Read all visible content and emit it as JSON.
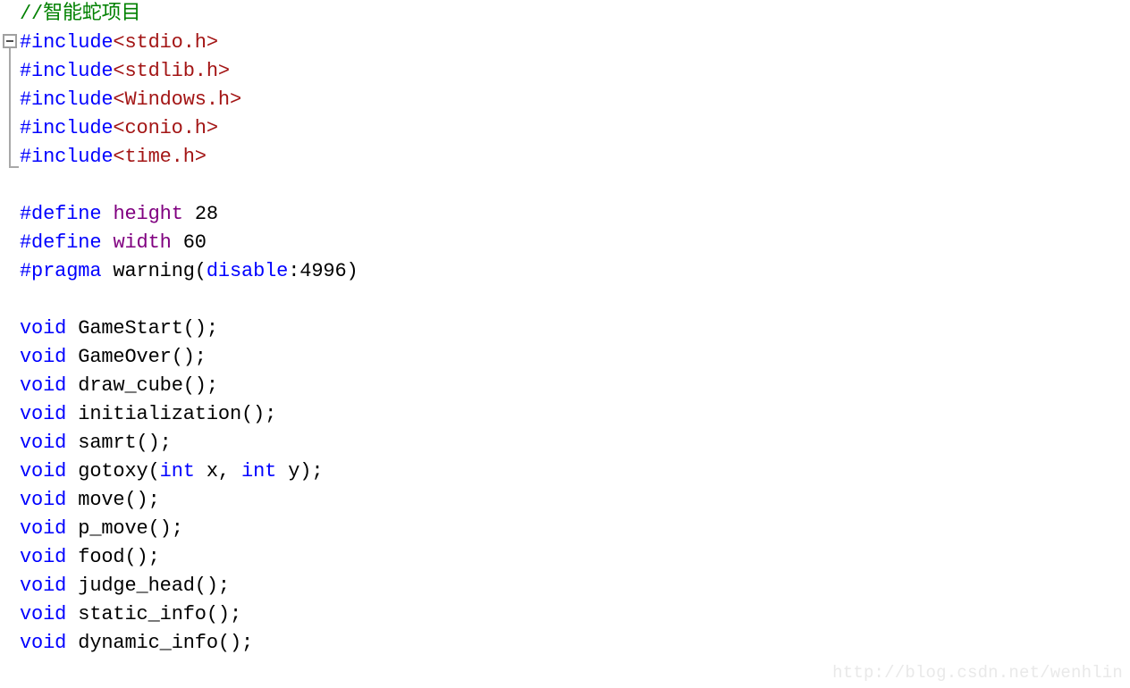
{
  "editor": {
    "background_color": "#ffffff",
    "font_size_px": 22,
    "line_height_px": 32,
    "colors": {
      "comment": "#008000",
      "preprocessor": "#0000ff",
      "header_name": "#a31515",
      "macro_name": "#800080",
      "keyword": "#0000ff",
      "plain_text": "#000000",
      "fold_margin": "#a8a8a8",
      "watermark": "#e9e9e9"
    },
    "fold_region": {
      "glyph": "minus-box",
      "collapsed": false,
      "covers_lines": "2-6"
    },
    "lines": [
      {
        "n": 1,
        "tokens": [
          {
            "t": "//智能蛇项目",
            "c": "comment"
          }
        ]
      },
      {
        "n": 2,
        "tokens": [
          {
            "t": "#include",
            "c": "pre"
          },
          {
            "t": "<stdio.h>",
            "c": "header"
          }
        ]
      },
      {
        "n": 3,
        "tokens": [
          {
            "t": "#include",
            "c": "pre"
          },
          {
            "t": "<stdlib.h>",
            "c": "header"
          }
        ]
      },
      {
        "n": 4,
        "tokens": [
          {
            "t": "#include",
            "c": "pre"
          },
          {
            "t": "<Windows.h>",
            "c": "header"
          }
        ]
      },
      {
        "n": 5,
        "tokens": [
          {
            "t": "#include",
            "c": "pre"
          },
          {
            "t": "<conio.h>",
            "c": "header"
          }
        ]
      },
      {
        "n": 6,
        "tokens": [
          {
            "t": "#include",
            "c": "pre"
          },
          {
            "t": "<time.h>",
            "c": "header"
          }
        ]
      },
      {
        "n": 7,
        "tokens": []
      },
      {
        "n": 8,
        "tokens": [
          {
            "t": "#define",
            "c": "pre"
          },
          {
            "t": " ",
            "c": "plain"
          },
          {
            "t": "height",
            "c": "macro"
          },
          {
            "t": " 28",
            "c": "plain"
          }
        ]
      },
      {
        "n": 9,
        "tokens": [
          {
            "t": "#define",
            "c": "pre"
          },
          {
            "t": " ",
            "c": "plain"
          },
          {
            "t": "width",
            "c": "macro"
          },
          {
            "t": " 60",
            "c": "plain"
          }
        ]
      },
      {
        "n": 10,
        "tokens": [
          {
            "t": "#pragma",
            "c": "pre"
          },
          {
            "t": " warning(",
            "c": "plain"
          },
          {
            "t": "disable",
            "c": "keyword"
          },
          {
            "t": ":4996)",
            "c": "plain"
          }
        ]
      },
      {
        "n": 11,
        "tokens": []
      },
      {
        "n": 12,
        "tokens": [
          {
            "t": "void",
            "c": "keyword"
          },
          {
            "t": " GameStart();",
            "c": "plain"
          }
        ]
      },
      {
        "n": 13,
        "tokens": [
          {
            "t": "void",
            "c": "keyword"
          },
          {
            "t": " GameOver();",
            "c": "plain"
          }
        ]
      },
      {
        "n": 14,
        "tokens": [
          {
            "t": "void",
            "c": "keyword"
          },
          {
            "t": " draw_cube();",
            "c": "plain"
          }
        ]
      },
      {
        "n": 15,
        "tokens": [
          {
            "t": "void",
            "c": "keyword"
          },
          {
            "t": " initialization();",
            "c": "plain"
          }
        ]
      },
      {
        "n": 16,
        "tokens": [
          {
            "t": "void",
            "c": "keyword"
          },
          {
            "t": " samrt();",
            "c": "plain"
          }
        ]
      },
      {
        "n": 17,
        "tokens": [
          {
            "t": "void",
            "c": "keyword"
          },
          {
            "t": " gotoxy(",
            "c": "plain"
          },
          {
            "t": "int",
            "c": "keyword"
          },
          {
            "t": " x, ",
            "c": "plain"
          },
          {
            "t": "int",
            "c": "keyword"
          },
          {
            "t": " y);",
            "c": "plain"
          }
        ]
      },
      {
        "n": 18,
        "tokens": [
          {
            "t": "void",
            "c": "keyword"
          },
          {
            "t": " move();",
            "c": "plain"
          }
        ]
      },
      {
        "n": 19,
        "tokens": [
          {
            "t": "void",
            "c": "keyword"
          },
          {
            "t": " p_move();",
            "c": "plain"
          }
        ]
      },
      {
        "n": 20,
        "tokens": [
          {
            "t": "void",
            "c": "keyword"
          },
          {
            "t": " food();",
            "c": "plain"
          }
        ]
      },
      {
        "n": 21,
        "tokens": [
          {
            "t": "void",
            "c": "keyword"
          },
          {
            "t": " judge_head();",
            "c": "plain"
          }
        ]
      },
      {
        "n": 22,
        "tokens": [
          {
            "t": "void",
            "c": "keyword"
          },
          {
            "t": " static_info();",
            "c": "plain"
          }
        ]
      },
      {
        "n": 23,
        "tokens": [
          {
            "t": "void",
            "c": "keyword"
          },
          {
            "t": " dynamic_info();",
            "c": "plain"
          }
        ]
      }
    ]
  },
  "watermark": {
    "text": "http://blog.csdn.net/wenhlin"
  }
}
